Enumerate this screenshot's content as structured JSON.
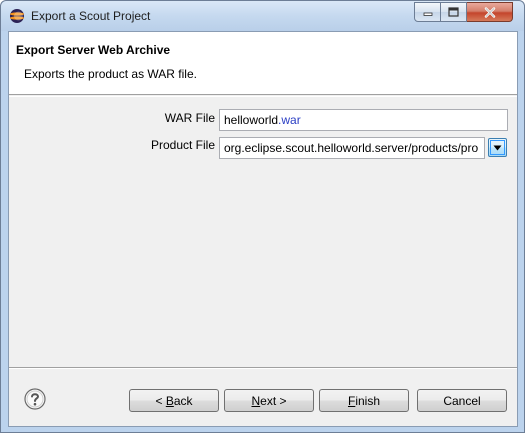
{
  "window": {
    "title": "Export a Scout Project"
  },
  "banner": {
    "title": "Export Server Web Archive",
    "description": "Exports the product as WAR file."
  },
  "form": {
    "war_file_label": "WAR File",
    "war_file_value_base": "helloworld",
    "war_file_value_ext": ".war",
    "product_file_label": "Product File",
    "product_file_value": "org.eclipse.scout.helloworld.server/products/pro"
  },
  "buttons": {
    "back_prefix": "< ",
    "back_mnemonic": "B",
    "back_rest": "ack",
    "next_mnemonic": "N",
    "next_rest": "ext >",
    "finish_mnemonic": "F",
    "finish_rest": "inish",
    "cancel_label": "Cancel"
  },
  "icons": {
    "app": "eclipse-icon",
    "help": "help-icon",
    "minimize": "minimize-icon",
    "maximize": "maximize-icon",
    "close": "close-icon",
    "dropdown": "chevron-down-icon"
  },
  "colors": {
    "war_extension": "#2a3ec4",
    "window_frame": "#bcd3ed",
    "close_button": "#c4452c"
  }
}
